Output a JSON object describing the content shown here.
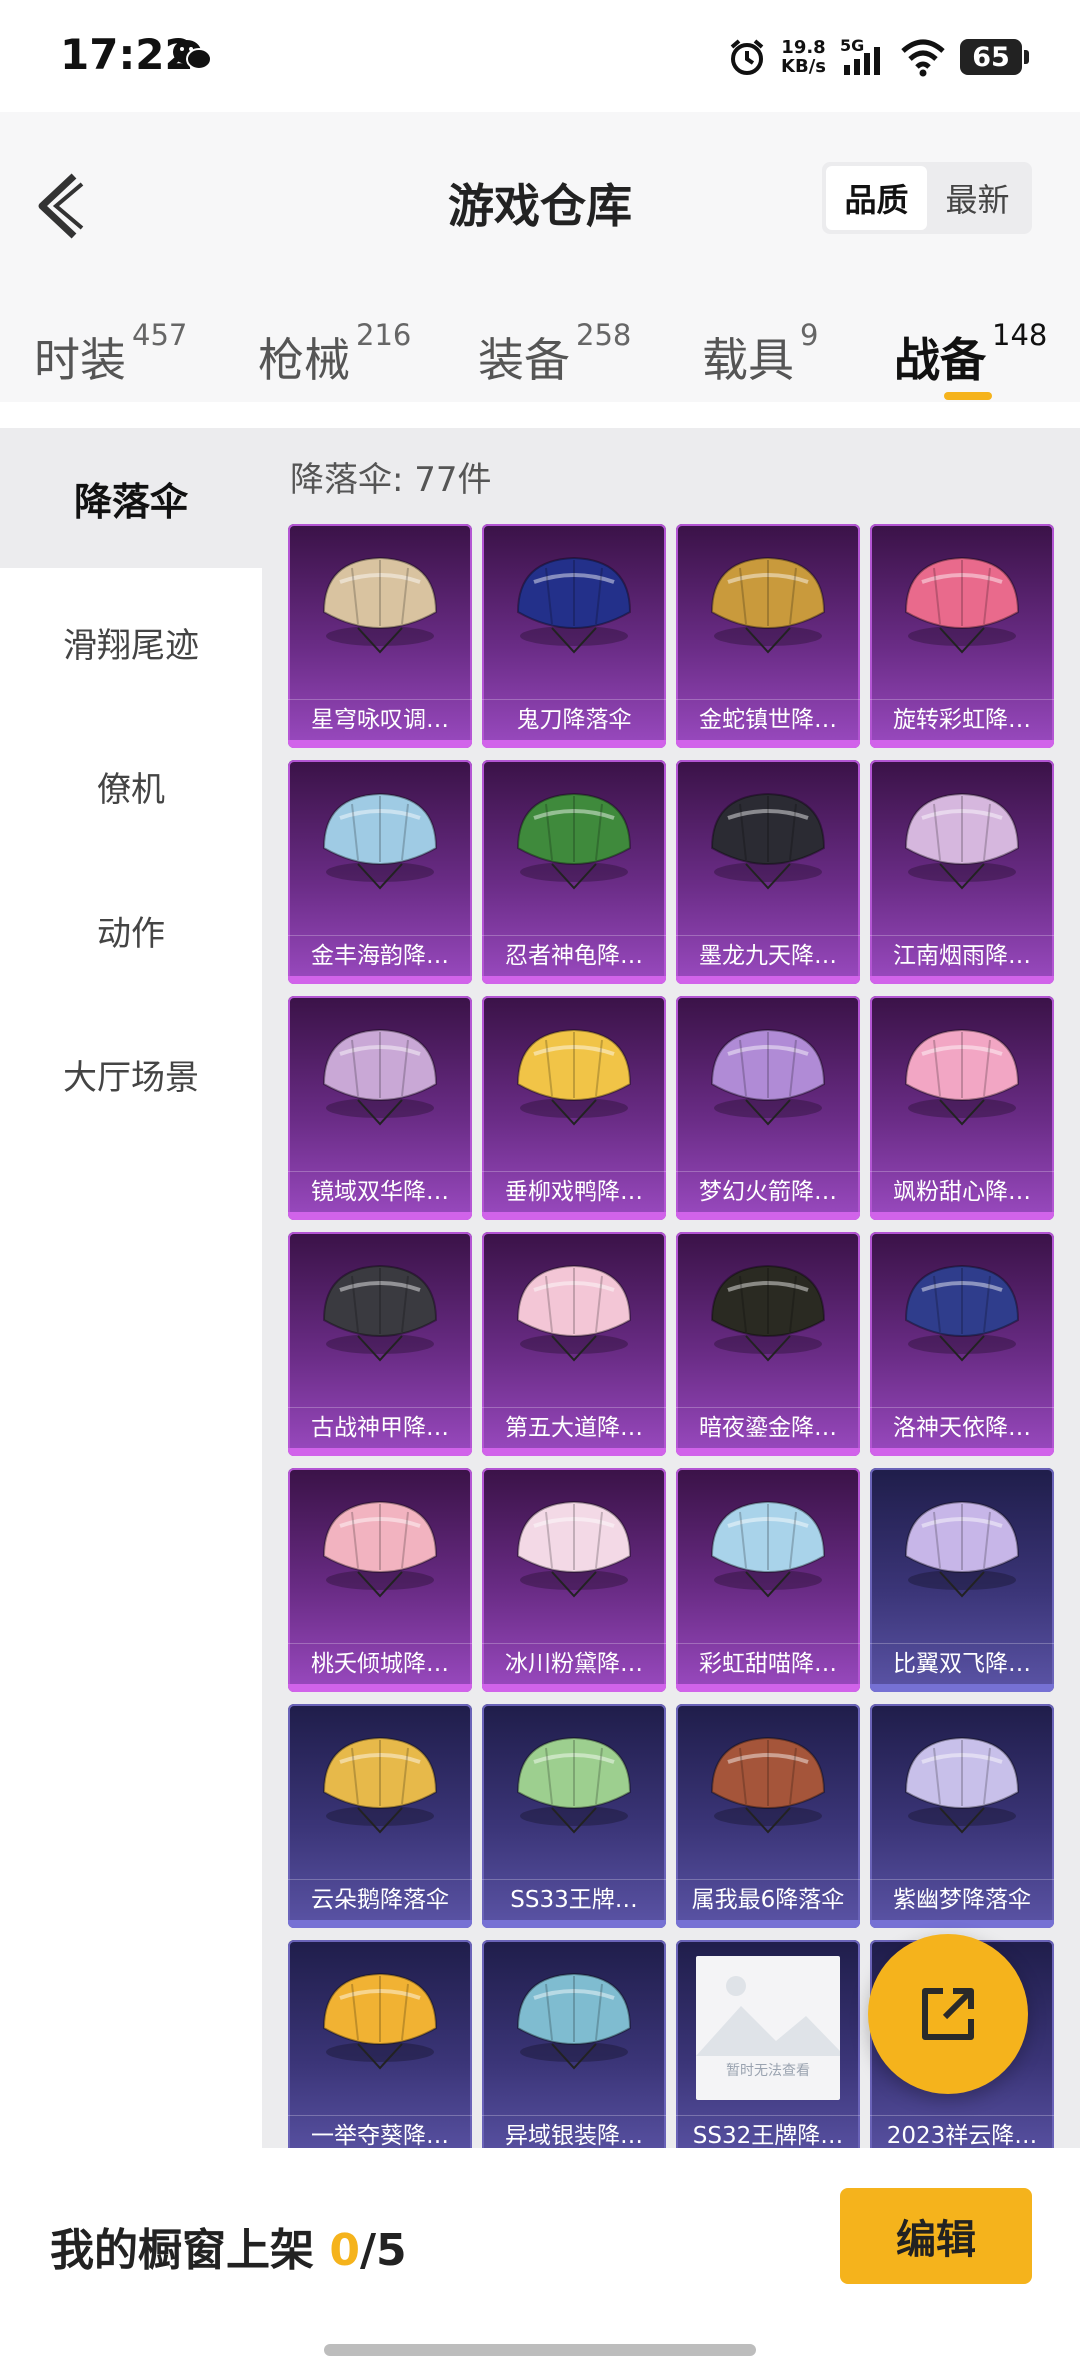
{
  "status_bar": {
    "time": "17:22",
    "net_speed": "19.8",
    "net_unit": "KB/s",
    "network": "5G",
    "battery": "65"
  },
  "header": {
    "title": "游戏仓库",
    "sort_options": [
      "品质",
      "最新"
    ],
    "active_sort": 0
  },
  "tabs": [
    {
      "label": "时装",
      "count": "457"
    },
    {
      "label": "枪械",
      "count": "216"
    },
    {
      "label": "装备",
      "count": "258"
    },
    {
      "label": "载具",
      "count": "9"
    },
    {
      "label": "战备",
      "count": "148"
    }
  ],
  "active_tab": 4,
  "sidebar": {
    "items": [
      "降落伞",
      "滑翔尾迹",
      "僚机",
      "动作",
      "大厅场景"
    ],
    "active": 0
  },
  "content": {
    "count_label": "降落伞: 77件",
    "placeholder_text": "暂时无法查看",
    "items": [
      {
        "name": "星穹咏叹调…",
        "color": "#d9c3a0",
        "tier": "purple"
      },
      {
        "name": "鬼刀降落伞",
        "color": "#23308a",
        "tier": "purple"
      },
      {
        "name": "金蛇镇世降…",
        "color": "#c99a3c",
        "tier": "purple"
      },
      {
        "name": "旋转彩虹降…",
        "color": "#e96a8c",
        "tier": "purple"
      },
      {
        "name": "金丰海韵降…",
        "color": "#9fcbe4",
        "tier": "purple"
      },
      {
        "name": "忍者神龟降…",
        "color": "#3f8a3c",
        "tier": "purple"
      },
      {
        "name": "墨龙九天降…",
        "color": "#2b2b33",
        "tier": "purple"
      },
      {
        "name": "江南烟雨降…",
        "color": "#d6b7de",
        "tier": "purple"
      },
      {
        "name": "镜域双华降…",
        "color": "#c9a8d6",
        "tier": "purple"
      },
      {
        "name": "垂柳戏鸭降…",
        "color": "#f1c447",
        "tier": "purple"
      },
      {
        "name": "梦幻火箭降…",
        "color": "#b08bd6",
        "tier": "purple"
      },
      {
        "name": "飒粉甜心降…",
        "color": "#f2a6c4",
        "tier": "purple"
      },
      {
        "name": "古战神甲降…",
        "color": "#3a3a40",
        "tier": "purple"
      },
      {
        "name": "第五大道降…",
        "color": "#f3c6d6",
        "tier": "purple"
      },
      {
        "name": "暗夜鎏金降…",
        "color": "#2a2a22",
        "tier": "purple"
      },
      {
        "name": "洛神天依降…",
        "color": "#2f3d8c",
        "tier": "purple"
      },
      {
        "name": "桃夭倾城降…",
        "color": "#f2b3c0",
        "tier": "purple"
      },
      {
        "name": "冰川粉黛降…",
        "color": "#f3d9e6",
        "tier": "purple"
      },
      {
        "name": "彩虹甜喵降…",
        "color": "#a9d3ea",
        "tier": "purple"
      },
      {
        "name": "比翼双飞降…",
        "color": "#c7b6e8",
        "tier": "blue"
      },
      {
        "name": "云朵鹅降落伞",
        "color": "#e7b94a",
        "tier": "blue"
      },
      {
        "name": "SS33王牌…",
        "color": "#9dcf8f",
        "tier": "blue"
      },
      {
        "name": "属我最6降落伞",
        "color": "#a5553a",
        "tier": "blue"
      },
      {
        "name": "紫幽梦降落伞",
        "color": "#c8c0ea",
        "tier": "blue"
      },
      {
        "name": "一举夺葵降…",
        "color": "#f1b233",
        "tier": "blue"
      },
      {
        "name": "异域银装降…",
        "color": "#7fbcd0",
        "tier": "blue"
      },
      {
        "name": "SS32王牌降…",
        "color": "#e6e6ea",
        "tier": "blue",
        "placeholder": true
      },
      {
        "name": "2023祥云降…",
        "color": "#8c86c8",
        "tier": "blue"
      }
    ]
  },
  "bottom_bar": {
    "showcase_label": "我的橱窗上架",
    "showcase_current": "0",
    "showcase_total": "/5",
    "edit_label": "编辑"
  }
}
